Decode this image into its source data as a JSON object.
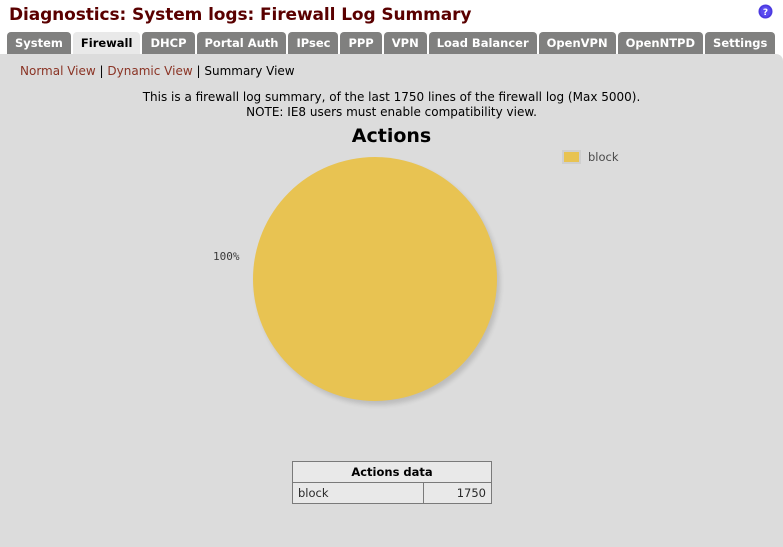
{
  "header": {
    "title": "Diagnostics: System logs: Firewall Log Summary",
    "help_icon": "help-question-icon"
  },
  "tabs": [
    {
      "label": "System",
      "active": false
    },
    {
      "label": "Firewall",
      "active": true
    },
    {
      "label": "DHCP",
      "active": false
    },
    {
      "label": "Portal Auth",
      "active": false
    },
    {
      "label": "IPsec",
      "active": false
    },
    {
      "label": "PPP",
      "active": false
    },
    {
      "label": "VPN",
      "active": false
    },
    {
      "label": "Load Balancer",
      "active": false
    },
    {
      "label": "OpenVPN",
      "active": false
    },
    {
      "label": "OpenNTPD",
      "active": false
    },
    {
      "label": "Settings",
      "active": false
    }
  ],
  "subnav": {
    "normal_view": "Normal View",
    "separator_1": "|",
    "dynamic_view": "Dynamic View",
    "separator_2": "|",
    "summary_view": "Summary View"
  },
  "description": {
    "line1": "This is a firewall log summary, of the last 1750 lines of the firewall log (Max 5000).",
    "line2": "NOTE: IE8 users must enable compatibility view."
  },
  "colors": {
    "accent_block": "#e8c352",
    "title": "#5a0000",
    "link": "#8a3324",
    "tab_inactive": "#80807f",
    "panel": "#dcdcdc"
  },
  "chart_data": {
    "type": "pie",
    "title": "Actions",
    "categories": [
      "block"
    ],
    "values": [
      1750
    ],
    "percentages": [
      "100%"
    ],
    "slice_colors": [
      "#e8c352"
    ],
    "legend": [
      "block"
    ],
    "legend_position": "right",
    "data_labels": [
      "100%"
    ]
  },
  "table": {
    "header": "Actions data",
    "rows": [
      {
        "label": "block",
        "value": "1750"
      }
    ]
  }
}
